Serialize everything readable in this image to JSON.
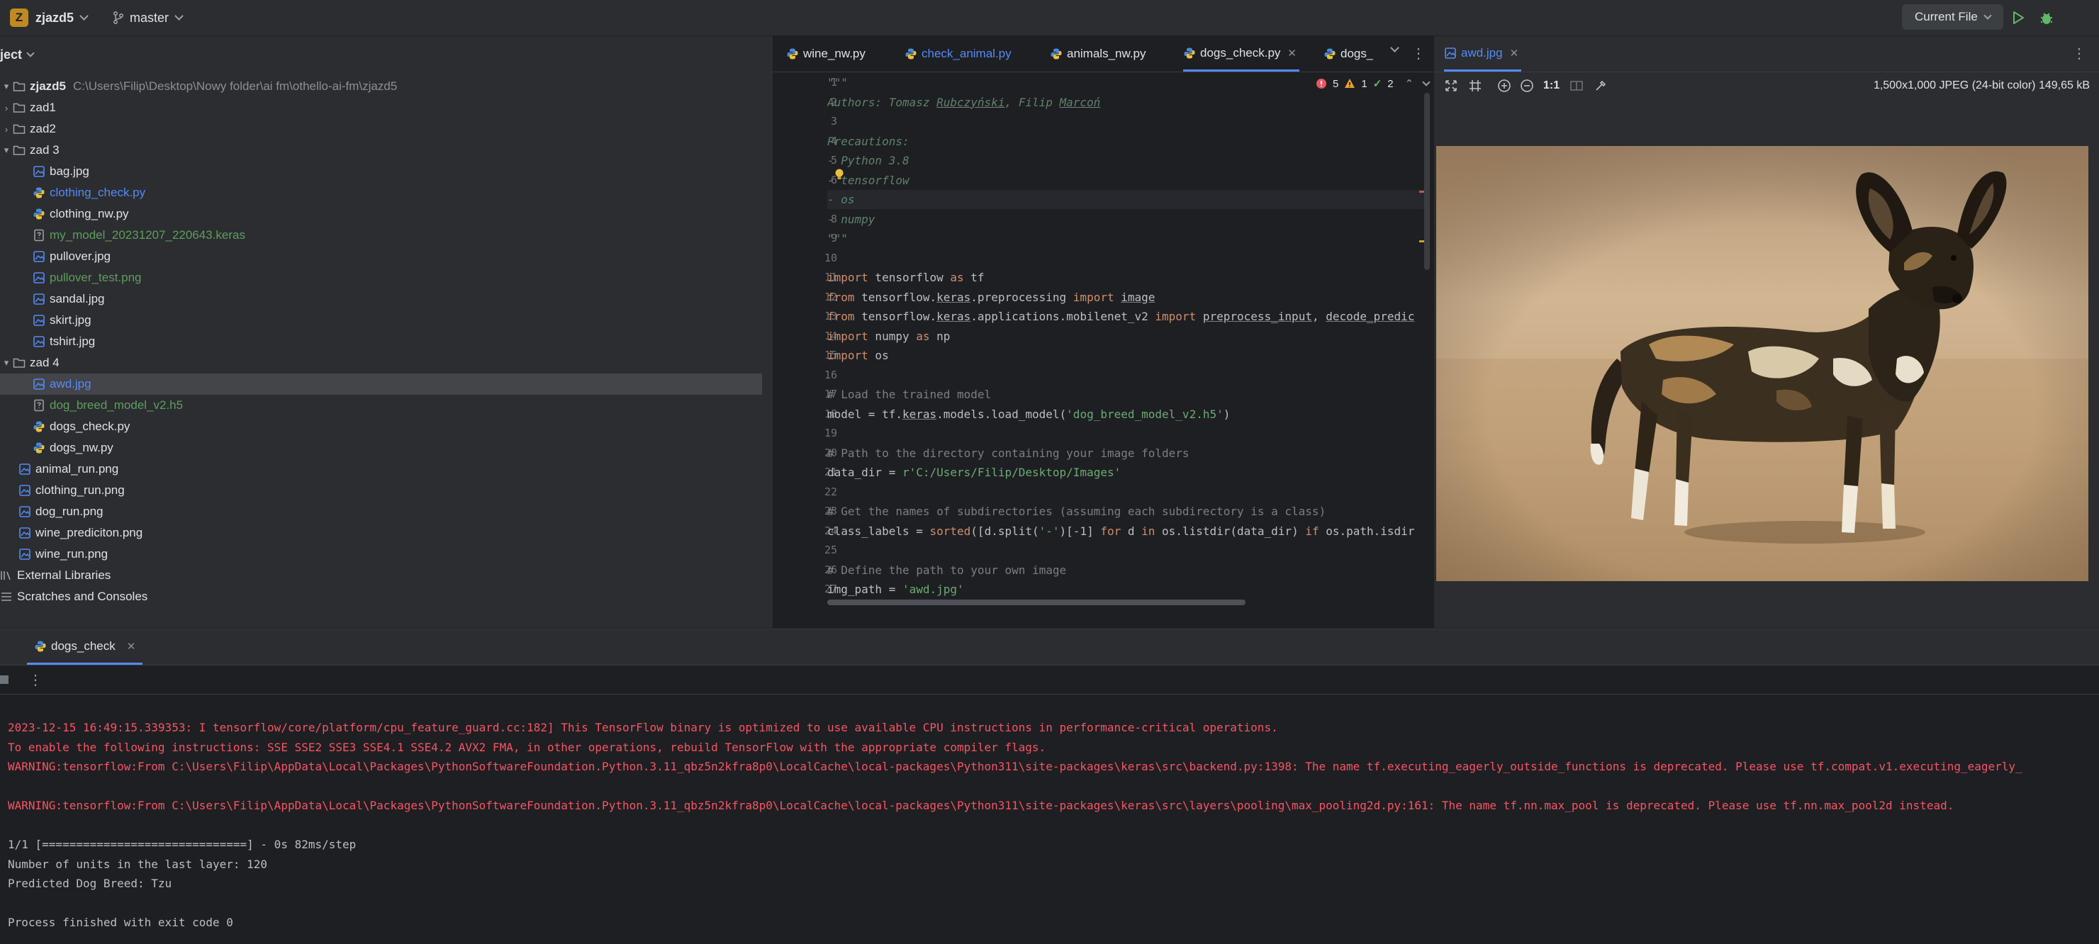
{
  "titlebar": {
    "project_badge": "Z",
    "project_name": "zjazd5",
    "branch": "master",
    "run_config": "Current File"
  },
  "project_panel": {
    "header": "ject",
    "root": {
      "name": "zjazd5",
      "path": "C:\\Users\\Filip\\Desktop\\Nowy folder\\ai fm\\othello-ai-fm\\zjazd5"
    },
    "items": [
      {
        "label": "zad1",
        "kind": "folder",
        "level": 1,
        "expanded": false,
        "status": "normal"
      },
      {
        "label": "zad2",
        "kind": "folder",
        "level": 1,
        "expanded": false,
        "status": "normal"
      },
      {
        "label": "zad 3",
        "kind": "folder",
        "level": 1,
        "expanded": true,
        "status": "normal"
      },
      {
        "label": "bag.jpg",
        "kind": "image",
        "level": 2,
        "status": "normal"
      },
      {
        "label": "clothing_check.py",
        "kind": "python",
        "level": 2,
        "status": "modified"
      },
      {
        "label": "clothing_nw.py",
        "kind": "python",
        "level": 2,
        "status": "normal"
      },
      {
        "label": "my_model_20231207_220643.keras",
        "kind": "file",
        "level": 2,
        "status": "new"
      },
      {
        "label": "pullover.jpg",
        "kind": "image",
        "level": 2,
        "status": "normal"
      },
      {
        "label": "pullover_test.png",
        "kind": "image",
        "level": 2,
        "status": "new"
      },
      {
        "label": "sandal.jpg",
        "kind": "image",
        "level": 2,
        "status": "normal"
      },
      {
        "label": "skirt.jpg",
        "kind": "image",
        "level": 2,
        "status": "normal"
      },
      {
        "label": "tshirt.jpg",
        "kind": "image",
        "level": 2,
        "status": "normal"
      },
      {
        "label": "zad 4",
        "kind": "folder",
        "level": 1,
        "expanded": true,
        "status": "normal"
      },
      {
        "label": "awd.jpg",
        "kind": "image",
        "level": 2,
        "status": "modified",
        "selected": true
      },
      {
        "label": "dog_breed_model_v2.h5",
        "kind": "file",
        "level": 2,
        "status": "new"
      },
      {
        "label": "dogs_check.py",
        "kind": "python",
        "level": 2,
        "status": "normal"
      },
      {
        "label": "dogs_nw.py",
        "kind": "python",
        "level": 2,
        "status": "normal"
      },
      {
        "label": "animal_run.png",
        "kind": "image",
        "level": 1,
        "status": "normal"
      },
      {
        "label": "clothing_run.png",
        "kind": "image",
        "level": 1,
        "status": "normal"
      },
      {
        "label": "dog_run.png",
        "kind": "image",
        "level": 1,
        "status": "normal"
      },
      {
        "label": "wine_prediciton.png",
        "kind": "image",
        "level": 1,
        "status": "normal"
      },
      {
        "label": "wine_run.png",
        "kind": "image",
        "level": 1,
        "status": "normal"
      }
    ],
    "external_libraries": "External Libraries",
    "scratches": "Scratches and Consoles"
  },
  "editor": {
    "tabs": [
      {
        "label": "wine_nw.py",
        "status": "normal"
      },
      {
        "label": "check_animal.py",
        "status": "modified"
      },
      {
        "label": "animals_nw.py",
        "status": "normal"
      },
      {
        "label": "dogs_check.py",
        "status": "active"
      },
      {
        "label": "dogs_",
        "status": "normal"
      }
    ],
    "inspections": {
      "errors": "5",
      "warnings": "1",
      "ok": "2"
    },
    "lines": [
      {
        "n": "1",
        "html": "<span class='doc'>\"\"\"</span>"
      },
      {
        "n": "2",
        "html": "<span class='doc'>Authors: Tomasz <span class='ul'>Rubczyński</span>, Filip <span class='ul'>Marcoń</span></span>"
      },
      {
        "n": "3",
        "html": ""
      },
      {
        "n": "4",
        "html": "<span class='doc'>Precautions:</span>"
      },
      {
        "n": "5",
        "html": "<span class='doc'>- Python 3.8</span>"
      },
      {
        "n": "6",
        "html": "<span class='doc'>- tensorflow</span>"
      },
      {
        "n": "7",
        "html": "<span class='doc'>- os</span>"
      },
      {
        "n": "8",
        "html": "<span class='doc'>- numpy</span>"
      },
      {
        "n": "9",
        "html": "<span class='doc'>\"\"\"</span>"
      },
      {
        "n": "10",
        "html": ""
      },
      {
        "n": "11",
        "html": "<span class='kw'>import</span> tensorflow <span class='kw'>as</span> tf"
      },
      {
        "n": "12",
        "html": "<span class='kw'>from</span> tensorflow.<span class='ul'>keras</span>.preprocessing <span class='kw'>import</span> <span class='ul'>image</span>"
      },
      {
        "n": "13",
        "html": "<span class='kw'>from</span> tensorflow.<span class='ul'>keras</span>.applications.mobilenet_v2 <span class='kw'>import</span> <span class='ul'>preprocess_input</span>, <span class='ul'>decode_predic</span>"
      },
      {
        "n": "14",
        "html": "<span class='kw'>import</span> numpy <span class='kw'>as</span> np"
      },
      {
        "n": "15",
        "html": "<span class='kw'>import</span> os"
      },
      {
        "n": "16",
        "html": ""
      },
      {
        "n": "17",
        "html": "<span class='cm'># Load the trained model</span>"
      },
      {
        "n": "18",
        "html": "model = tf.<span class='ul'>keras</span>.models.load_model(<span class='st'>'dog_breed_model_v2.h5'</span>)"
      },
      {
        "n": "19",
        "html": ""
      },
      {
        "n": "20",
        "html": "<span class='cm'># Path to the directory containing your image folders</span>"
      },
      {
        "n": "21",
        "html": "data_dir = <span class='st'>r'C:/Users/Filip/Desktop/Images'</span>"
      },
      {
        "n": "22",
        "html": ""
      },
      {
        "n": "23",
        "html": "<span class='cm'># Get the names of subdirectories (assuming each subdirectory is a class)</span>"
      },
      {
        "n": "24",
        "html": "class_labels = <span class='kw'>sorted</span>([d.split(<span class='st'>'-'</span>)[-1] <span class='kw'>for</span> d <span class='kw'>in</span> os.listdir(data_dir) <span class='kw'>if</span> os.path.isdir"
      },
      {
        "n": "25",
        "html": ""
      },
      {
        "n": "26",
        "html": "<span class='cm'># Define the path to your own image</span>"
      },
      {
        "n": "27",
        "html": "img_path = <span class='st'>'awd.jpg'</span>"
      }
    ]
  },
  "viewer": {
    "tab_label": "awd.jpg",
    "zoom_actual": "1:1",
    "image_info": "1,500x1,000 JPEG (24-bit color) 149,65 kB"
  },
  "run_panel": {
    "tab_label": "dogs_check",
    "output": [
      {
        "type": "err",
        "text": "2023-12-15 16:49:15.339353: I tensorflow/core/platform/cpu_feature_guard.cc:182] This TensorFlow binary is optimized to use available CPU instructions in performance-critical operations."
      },
      {
        "type": "err",
        "text": "To enable the following instructions: SSE SSE2 SSE3 SSE4.1 SSE4.2 AVX2 FMA, in other operations, rebuild TensorFlow with the appropriate compiler flags."
      },
      {
        "type": "err",
        "text": "WARNING:tensorflow:From C:\\Users\\Filip\\AppData\\Local\\Packages\\PythonSoftwareFoundation.Python.3.11_qbz5n2kfra8p0\\LocalCache\\local-packages\\Python311\\site-packages\\keras\\src\\backend.py:1398: The name tf.executing_eagerly_outside_functions is deprecated. Please use tf.compat.v1.executing_eagerly_"
      },
      {
        "type": "norm",
        "text": ""
      },
      {
        "type": "err",
        "text": "WARNING:tensorflow:From C:\\Users\\Filip\\AppData\\Local\\Packages\\PythonSoftwareFoundation.Python.3.11_qbz5n2kfra8p0\\LocalCache\\local-packages\\Python311\\site-packages\\keras\\src\\layers\\pooling\\max_pooling2d.py:161: The name tf.nn.max_pool is deprecated. Please use tf.nn.max_pool2d instead."
      },
      {
        "type": "norm",
        "text": ""
      },
      {
        "type": "norm",
        "text": "1/1 [==============================] - 0s 82ms/step"
      },
      {
        "type": "norm",
        "text": "Number of units in the last layer: 120"
      },
      {
        "type": "norm",
        "text": "Predicted Dog Breed: Tzu"
      },
      {
        "type": "norm",
        "text": ""
      },
      {
        "type": "norm",
        "text": "Process finished with exit code 0"
      }
    ]
  }
}
